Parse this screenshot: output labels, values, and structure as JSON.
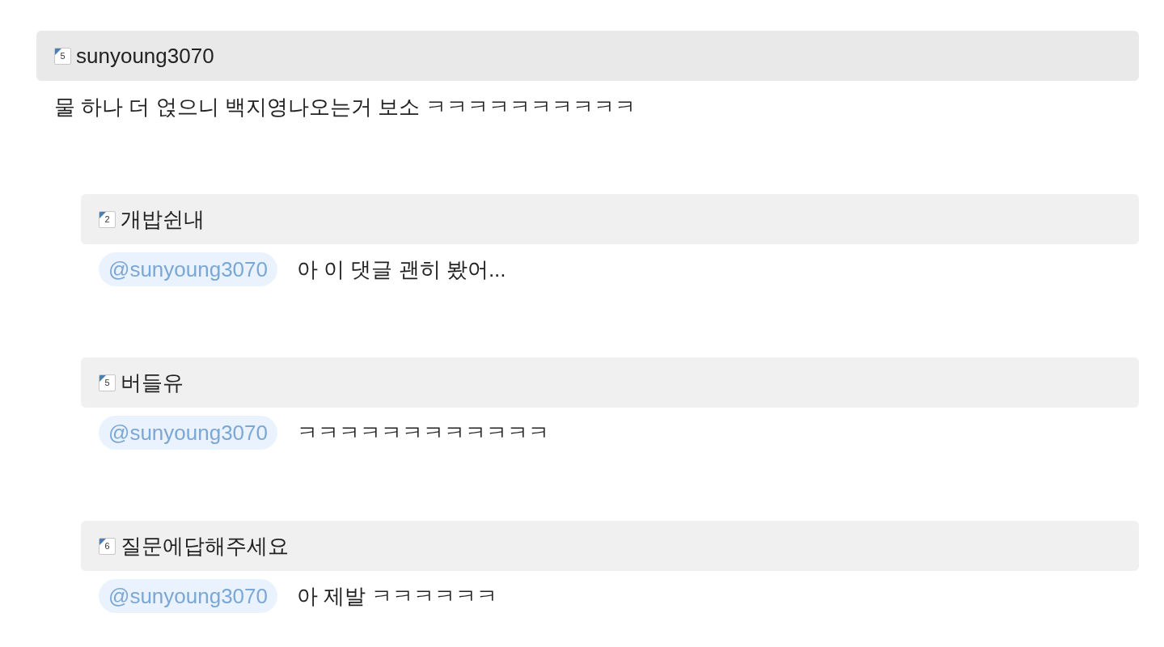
{
  "comment": {
    "author": "sunyoung3070",
    "rank": "5",
    "text": "물 하나 더 얹으니 백지영나오는거 보소 ㅋㅋㅋㅋㅋㅋㅋㅋㅋㅋ"
  },
  "replies": [
    {
      "author": "개밥쉰내",
      "rank": "2",
      "mention": "@sunyoung3070",
      "text": "아 이 댓글 괜히 봤어..."
    },
    {
      "author": "버들유",
      "rank": "5",
      "mention": "@sunyoung3070",
      "text": "ㅋㅋㅋㅋㅋㅋㅋㅋㅋㅋㅋㅋ"
    },
    {
      "author": "질문에답해주세요",
      "rank": "6",
      "mention": "@sunyoung3070",
      "text": "아 제발 ㅋㅋㅋㅋㅋㅋ"
    }
  ]
}
